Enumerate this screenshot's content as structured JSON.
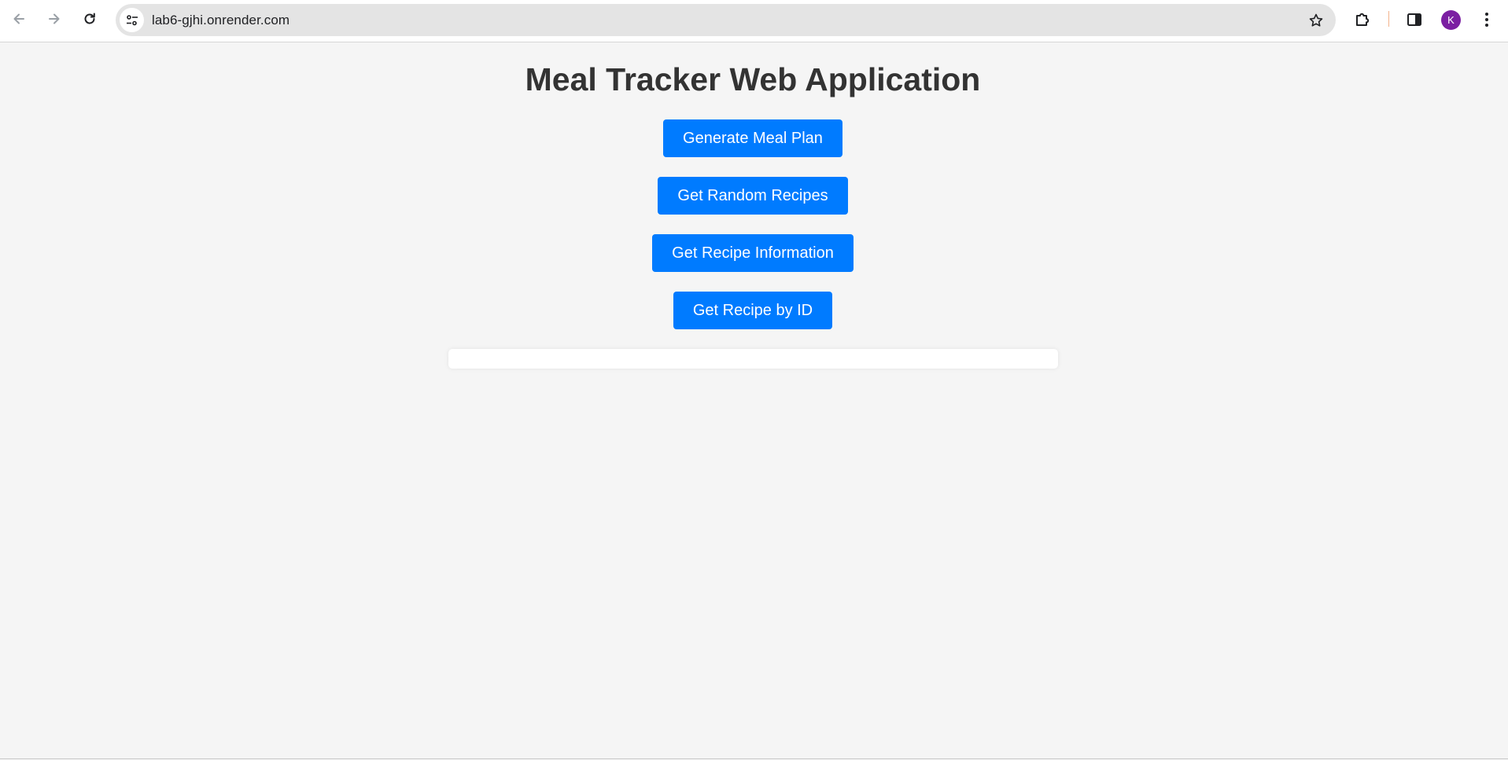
{
  "browser": {
    "url": "lab6-gjhi.onrender.com",
    "profile_initial": "K"
  },
  "page": {
    "title": "Meal Tracker Web Application",
    "buttons": [
      {
        "label": "Generate Meal Plan"
      },
      {
        "label": "Get Random Recipes"
      },
      {
        "label": "Get Recipe Information"
      },
      {
        "label": "Get Recipe by ID"
      }
    ]
  },
  "colors": {
    "button_bg": "#007bff",
    "page_bg": "#f5f5f5",
    "title": "#333333",
    "avatar": "#7b1fa2"
  },
  "icons": [
    "back-arrow-icon",
    "forward-arrow-icon",
    "reload-icon",
    "site-settings-icon",
    "bookmark-star-icon",
    "extensions-icon",
    "side-panel-icon",
    "more-menu-icon"
  ]
}
